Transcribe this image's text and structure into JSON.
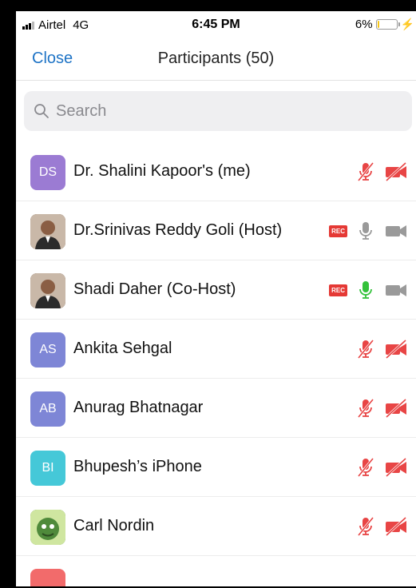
{
  "status_bar": {
    "carrier": "Airtel",
    "network": "4G",
    "time": "6:45 PM",
    "battery_percent": "6%",
    "battery_level": 0.06
  },
  "nav": {
    "close_label": "Close",
    "title": "Participants (50)"
  },
  "search": {
    "placeholder": "Search"
  },
  "participants": [
    {
      "name": "Dr. Shalini Kapoor's (me)",
      "initials": "DS",
      "avatar_color": "#9b7bd3",
      "rec": false,
      "mic": "muted",
      "video": "off"
    },
    {
      "name": "Dr.Srinivas Reddy Goli (Host)",
      "initials": "",
      "avatar_color": "#6f5243",
      "rec": true,
      "rec_label": "REC",
      "mic": "on",
      "video": "on"
    },
    {
      "name": "Shadi Daher (Co-Host)",
      "initials": "",
      "avatar_color": "#5a4536",
      "rec": true,
      "rec_label": "REC",
      "mic": "speaking",
      "video": "on"
    },
    {
      "name": "Ankita Sehgal",
      "initials": "AS",
      "avatar_color": "#7e86d6",
      "rec": false,
      "mic": "muted",
      "video": "off"
    },
    {
      "name": "Anurag Bhatnagar",
      "initials": "AB",
      "avatar_color": "#7e86d6",
      "rec": false,
      "mic": "muted",
      "video": "off"
    },
    {
      "name": "Bhupesh’s iPhone",
      "initials": "BI",
      "avatar_color": "#45c8d8",
      "rec": false,
      "mic": "muted",
      "video": "off"
    },
    {
      "name": "Carl Nordin",
      "initials": "",
      "avatar_color": "#4f8a3b",
      "rec": false,
      "mic": "muted",
      "video": "off"
    },
    {
      "name": "",
      "initials": "",
      "avatar_color": "#f26b6b",
      "rec": false,
      "mic": "muted",
      "video": "off"
    }
  ],
  "colors": {
    "accent": "#1f74c6",
    "muted_red": "#e84545",
    "speaking_green": "#34c23b",
    "idle_gray": "#9a9a9a"
  }
}
